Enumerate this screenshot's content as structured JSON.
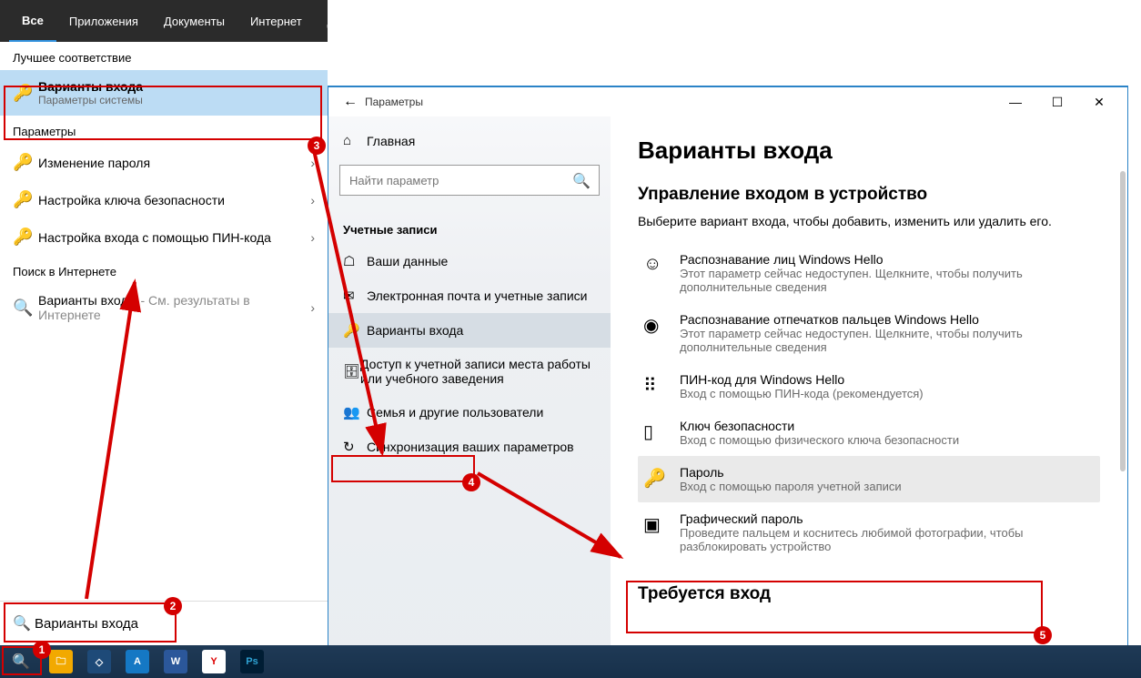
{
  "search": {
    "tabs": [
      "Все",
      "Приложения",
      "Документы",
      "Интернет",
      "Другие"
    ],
    "bestMatchLabel": "Лучшее соответствие",
    "bestMatch": {
      "title": "Варианты входа",
      "sub": "Параметры системы"
    },
    "paramsLabel": "Параметры",
    "paramItems": [
      "Изменение пароля",
      "Настройка ключа безопасности",
      "Настройка входа с помощью ПИН-кода"
    ],
    "webLabel": "Поиск в Интернете",
    "webItem": {
      "title": "Варианты входы",
      "tail": " - См. результаты в Интернете"
    },
    "input": "Варианты входа"
  },
  "settings": {
    "windowTitle": "Параметры",
    "homeLabel": "Главная",
    "searchPlaceholder": "Найти параметр",
    "categoryLabel": "Учетные записи",
    "navItems": [
      "Ваши данные",
      "Электронная почта и учетные записи",
      "Варианты входа",
      "Доступ к учетной записи места работы или учебного заведения",
      "Семья и другие пользователи",
      "Синхронизация ваших параметров"
    ],
    "heading": "Варианты входа",
    "subheading": "Управление входом в устройство",
    "intro": "Выберите вариант входа, чтобы добавить, изменить или удалить его.",
    "options": [
      {
        "title": "Распознавание лиц Windows Hello",
        "sub": "Этот параметр сейчас недоступен. Щелкните, чтобы получить дополнительные сведения"
      },
      {
        "title": "Распознавание отпечатков пальцев Windows Hello",
        "sub": "Этот параметр сейчас недоступен. Щелкните, чтобы получить дополнительные сведения"
      },
      {
        "title": "ПИН-код для Windows Hello",
        "sub": "Вход с помощью ПИН-кода (рекомендуется)"
      },
      {
        "title": "Ключ безопасности",
        "sub": "Вход с помощью физического ключа безопасности"
      },
      {
        "title": "Пароль",
        "sub": "Вход с помощью пароля учетной записи"
      },
      {
        "title": "Графический пароль",
        "sub": "Проведите пальцем и коснитесь любимой фотографии, чтобы разблокировать устройство"
      }
    ],
    "footer": "Требуется вход"
  },
  "annotations": {
    "badges": [
      "1",
      "2",
      "3",
      "4",
      "5"
    ]
  }
}
